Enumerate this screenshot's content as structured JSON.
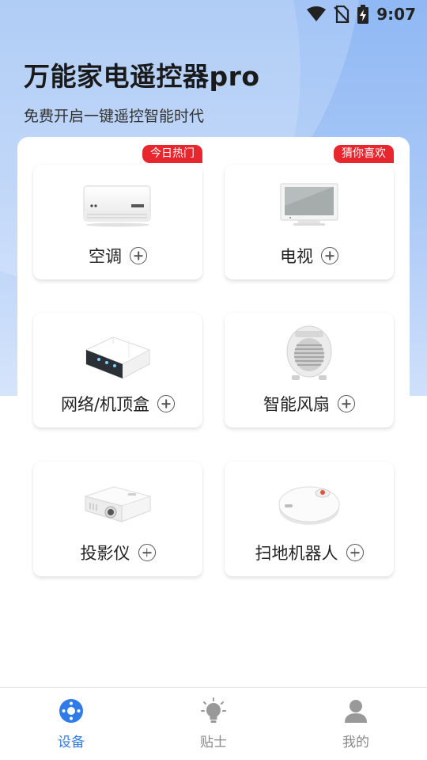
{
  "status_bar": {
    "time": "9:07"
  },
  "header": {
    "title": "万能家电遥控器pro",
    "subtitle": "免费开启一键遥控智能时代"
  },
  "devices": [
    {
      "label": "空调",
      "icon": "air-conditioner",
      "badge": "今日热门"
    },
    {
      "label": "电视",
      "icon": "tv",
      "badge": "猜你喜欢"
    },
    {
      "label": "网络/机顶盒",
      "icon": "set-top-box"
    },
    {
      "label": "智能风扇",
      "icon": "fan-heater"
    },
    {
      "label": "投影仪",
      "icon": "projector"
    },
    {
      "label": "扫地机器人",
      "icon": "robot-vacuum"
    }
  ],
  "bottom_nav": [
    {
      "label": "设备",
      "icon": "device-icon",
      "active": true
    },
    {
      "label": "贴士",
      "icon": "bulb-icon",
      "active": false
    },
    {
      "label": "我的",
      "icon": "user-icon",
      "active": false
    }
  ],
  "colors": {
    "accent": "#2f7bea",
    "badge": "#e8262e",
    "hero": "#a9c8f6"
  }
}
